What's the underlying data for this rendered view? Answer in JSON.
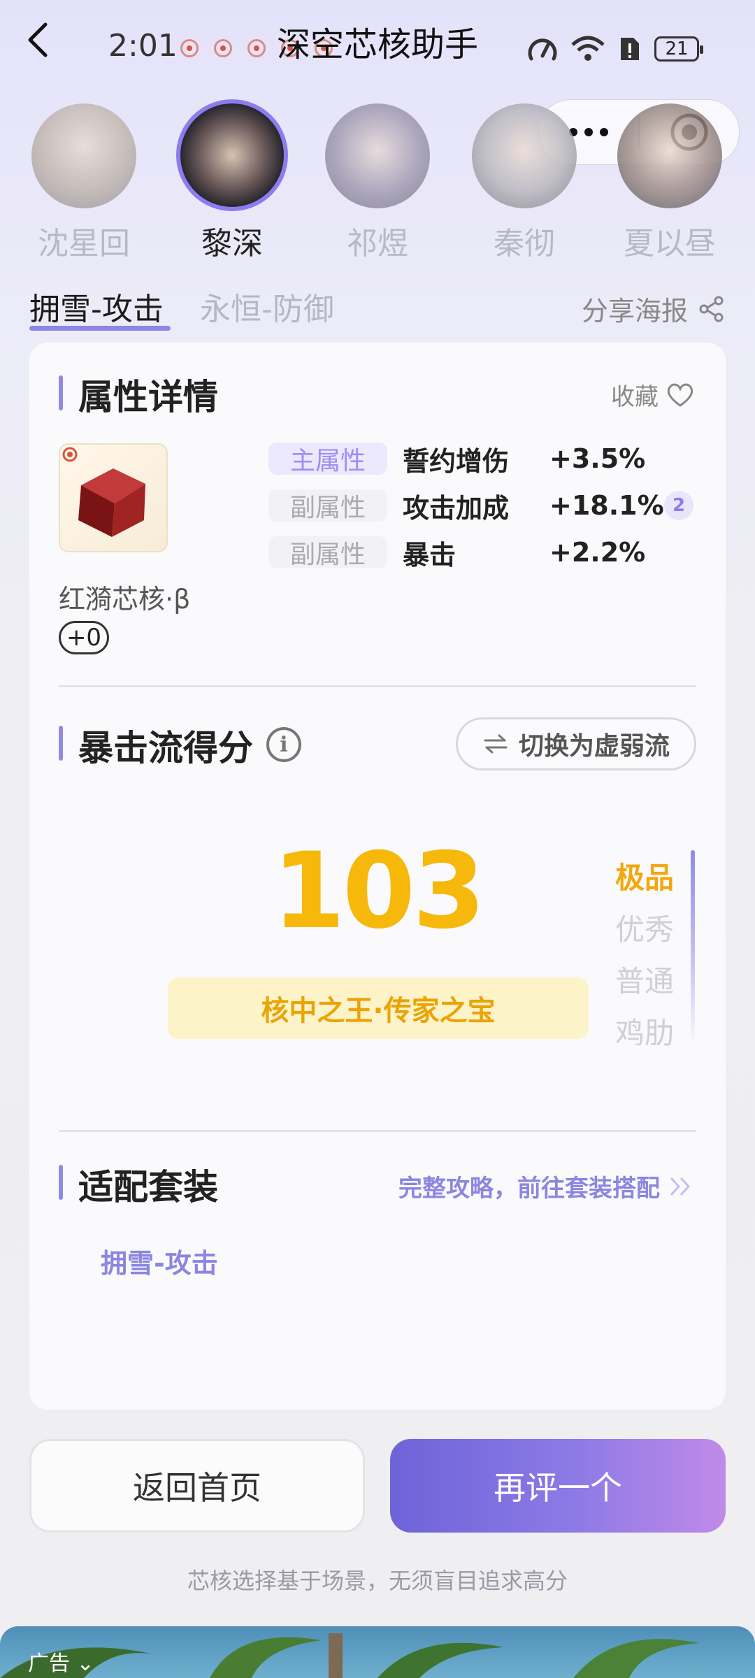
{
  "status_bar": {
    "time": "2:01",
    "battery": "21"
  },
  "header": {
    "title": "深空芯核助手"
  },
  "characters": [
    {
      "name": "沈星回",
      "active": false
    },
    {
      "name": "黎深",
      "active": true
    },
    {
      "name": "祁煜",
      "active": false
    },
    {
      "name": "秦彻",
      "active": false
    },
    {
      "name": "夏以昼",
      "active": false
    }
  ],
  "tabs": [
    {
      "label": "拥雪-攻击",
      "active": true
    },
    {
      "label": "永恒-防御",
      "active": false
    }
  ],
  "share_label": "分享海报",
  "attributes": {
    "section_title": "属性详情",
    "favorite_label": "收藏",
    "core_name": "红漪芯核·β",
    "level": "+0",
    "rows": [
      {
        "type": "主属性",
        "name": "誓约增伤",
        "value": "+3.5%"
      },
      {
        "type": "副属性",
        "name": "攻击加成",
        "value": "+18.1%",
        "count": "2"
      },
      {
        "type": "副属性",
        "name": "暴击",
        "value": "+2.2%"
      }
    ]
  },
  "score_section": {
    "title": "暴击流得分",
    "switch_label": "切换为虚弱流",
    "score": "103",
    "verdict": "核中之王·传家之宝",
    "tiers": [
      "极品",
      "优秀",
      "普通",
      "鸡肋"
    ],
    "current_tier": "极品"
  },
  "set_section": {
    "title": "适配套装",
    "strategy_link": "完整攻略，前往套装搭配",
    "set_name": "拥雪-攻击"
  },
  "buttons": {
    "home": "返回首页",
    "again": "再评一个"
  },
  "hint": "芯核选择基于场景，无须盲目追求高分",
  "ad_label": "广告"
}
